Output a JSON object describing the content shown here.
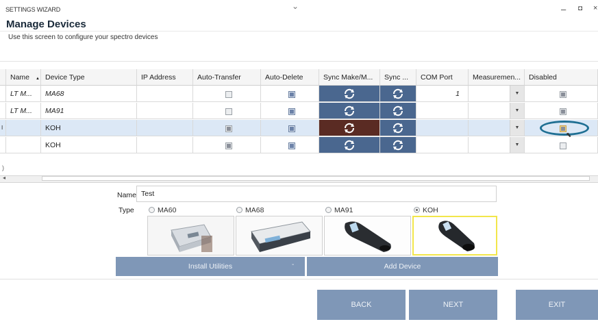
{
  "window": {
    "title": "SETTINGS WIZARD",
    "collapse_glyph": "⌄",
    "min_glyph": "–",
    "max_glyph": "◘",
    "close_glyph": "×"
  },
  "page": {
    "title": "Manage Devices",
    "subtitle": "Use this screen to configure your spectro devices"
  },
  "grid": {
    "columns": [
      "Name",
      "Device Type",
      "IP Address",
      "Auto-Transfer",
      "Auto-Delete",
      "Sync Make/M...",
      "Sync ...",
      "COM Port",
      "Measuremen...",
      "Disabled"
    ],
    "sort_indicator": "▲",
    "rows": [
      {
        "indicator": "",
        "name": "LT M...",
        "device_type": "MA68",
        "ip": "",
        "auto_transfer": false,
        "auto_delete": true,
        "com_port": "1",
        "measurement": "",
        "disabled": true,
        "italic": true
      },
      {
        "indicator": "",
        "name": "LT M...",
        "device_type": "MA91",
        "ip": "",
        "auto_transfer": false,
        "auto_delete": true,
        "com_port": "",
        "measurement": "",
        "disabled": true,
        "italic": true
      },
      {
        "indicator": "I",
        "name": "",
        "device_type": "KOH",
        "ip": "",
        "auto_transfer": true,
        "auto_delete": true,
        "com_port": "",
        "measurement": "",
        "disabled": true,
        "italic": false
      },
      {
        "indicator": "",
        "name": "",
        "device_type": "KOH",
        "ip": "",
        "auto_transfer": true,
        "auto_delete": true,
        "com_port": "",
        "measurement": "",
        "disabled": false,
        "italic": false
      }
    ],
    "dropdown_glyph": "▼"
  },
  "edge_mark": ")",
  "scroll_left_glyph": "◂",
  "form": {
    "name_label": "Name",
    "name_value": "Test",
    "type_label": "Type",
    "types": [
      {
        "label": "MA60",
        "selected": false
      },
      {
        "label": "MA68",
        "selected": false
      },
      {
        "label": "MA91",
        "selected": false
      },
      {
        "label": "KOH",
        "selected": true
      }
    ],
    "install_label": "Install Utilities",
    "install_caret": "-",
    "add_label": "Add Device"
  },
  "footer": {
    "back": "BACK",
    "next": "NEXT",
    "exit": "EXIT"
  },
  "colors": {
    "accent": "#7f97b7",
    "sync_blue": "#4a678f",
    "sync_active": "#5a2b23",
    "selected_row": "#dce8f6",
    "annotation_circle": "#1f6f93",
    "selected_image_border": "#f2e64a"
  }
}
